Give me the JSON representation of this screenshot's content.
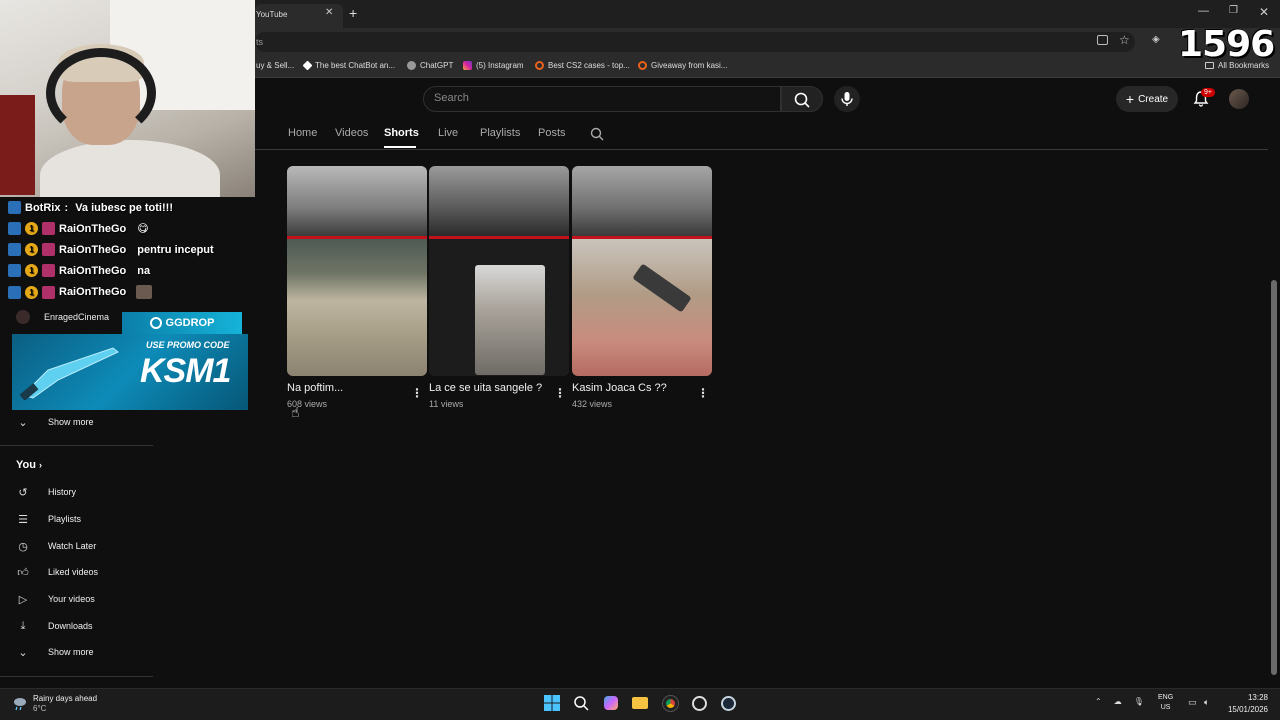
{
  "browser": {
    "tab_title": "YouTube",
    "tab_close": "✕",
    "new_tab": "+",
    "omnibox_text": "ts",
    "bookmarks": [
      {
        "label": "uy & Sell...",
        "color": "#888888"
      },
      {
        "label": "The best ChatBot an...",
        "color": "#ffffff"
      },
      {
        "label": "ChatGPT",
        "color": "#cccccc"
      },
      {
        "label": "(5) Instagram",
        "color": "#d6249f"
      },
      {
        "label": "Best CS2 cases - top...",
        "color": "#e8621c"
      },
      {
        "label": "Giveaway from kasi...",
        "color": "#e8621c"
      }
    ],
    "all_bookmarks": "All Bookmarks"
  },
  "overlay": {
    "viewer_count": "1596",
    "chat": [
      {
        "user": "BotRix",
        "msg": "Va iubesc pe toti!!!",
        "badges": [
          "blue"
        ]
      },
      {
        "user": "RaiOnTheGo",
        "msg": "😋",
        "badges": [
          "blue",
          "gold",
          "pink"
        ]
      },
      {
        "user": "RaiOnTheGo",
        "msg": "pentru inceput",
        "badges": [
          "blue",
          "gold",
          "pink"
        ]
      },
      {
        "user": "RaiOnTheGo",
        "msg": "na",
        "badges": [
          "blue",
          "gold",
          "pink"
        ]
      },
      {
        "user": "RaiOnTheGo",
        "msg": "",
        "badges": [
          "blue",
          "gold",
          "pink"
        ]
      }
    ],
    "sidebar_channel": "EnragedCinema",
    "ggdrop": {
      "brand": "GGDROP",
      "promo_label": "USE PROMO CODE",
      "code": "KSM1"
    }
  },
  "youtube": {
    "search_placeholder": "Search",
    "create_label": "Create",
    "notif_count": "9+",
    "channel_tabs": [
      "Home",
      "Videos",
      "Shorts",
      "Live",
      "Playlists",
      "Posts"
    ],
    "active_tab": "Shorts",
    "shorts": [
      {
        "title": "Na poftim...",
        "views": "608 views"
      },
      {
        "title": "La ce se uita sangele ?",
        "views": "11 views"
      },
      {
        "title": "Kasim Joaca Cs ??",
        "views": "432 views"
      }
    ],
    "sidebar": {
      "show_more_top": "Show more",
      "you_label": "You",
      "items": [
        "History",
        "Playlists",
        "Watch Later",
        "Liked videos",
        "Your videos",
        "Downloads"
      ],
      "show_more_bottom": "Show more"
    }
  },
  "taskbar": {
    "weather_title": "Rainy days ahead",
    "weather_temp": "6°C",
    "lang_line1": "ENG",
    "lang_line2": "US",
    "time": "13:28",
    "date": "15/01/2026"
  }
}
